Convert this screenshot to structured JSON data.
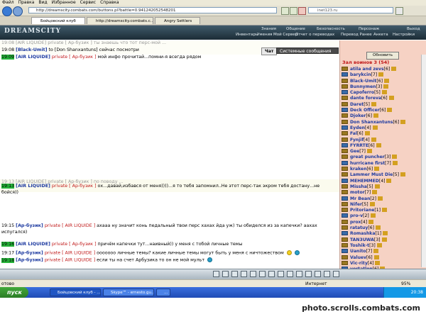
{
  "menu": [
    "Файл",
    "Правка",
    "Вид",
    "Избранное",
    "Сервис",
    "Справка"
  ],
  "address": {
    "url": "http://dreamscity.combats.com/buttons.pl?battle=0.941242052548201",
    "search": "inet123.ru"
  },
  "tabs": [
    {
      "label": "Бойцовский клуб"
    },
    {
      "label": "http://dreamscity.combats.c..."
    },
    {
      "label": "Angry Settlers"
    }
  ],
  "game": {
    "logo": "DREAMSCITY",
    "nav_top": [
      "Знания",
      "Общение",
      "Безопасность",
      "Персонаж",
      "Выход"
    ],
    "nav_bottom": [
      "Инвентарь",
      "Умения",
      "Мой Сервер",
      "Отчет о переводах",
      "Перевод Ранее",
      "Анкета",
      "Настройки"
    ]
  },
  "chat": {
    "tab_chat": "Чат",
    "tab_system": "Системные сообщения",
    "top_lines": [
      {
        "time": "19:08",
        "nick": "Black-Umit",
        "text": " to [Don Shanxantuns] сейчас посмотри"
      },
      {
        "time": "19:09",
        "nick": "AIR LIQUIDE",
        "private": "private [ Ар-бузик ]",
        "text": " мой инфо прочитай...помни-я всегда рядом"
      }
    ],
    "faded_top": "19:08 [AIR LIQUIDE] private [ Ар-бузик ] ты знаешь что тот перс-мой ...",
    "mid_lines": [
      {
        "time": "19:13",
        "nick": "AIR LIQUIDE",
        "private": "private [ Ар-бузик ]",
        "text": " ох...давай,избався от меня))))...я то тебя запомнил..Не этот перс-так экром тебя достану...не"
      },
      {
        "time": "",
        "nick": "",
        "private": "",
        "text": "бойся))"
      }
    ],
    "faded_mid": "19:13 [AIR LIQUIDE] private [ Ар-бузик ] по поводу ...",
    "bottom_lines": [
      {
        "time": "19:15",
        "nick": "Ар-бузик",
        "private": "private [ AIR LIQUIDE ]",
        "text": " ахааа ну значит конь педальный твои перс хахах йда уж) ты обиделся из за капечки? аахах"
      },
      {
        "time": "",
        "nick": "",
        "private": "",
        "text": "испугался)"
      },
      {
        "time": "19:16",
        "nick": "AIR LIQUIDE",
        "private": "private [ Ар-бузик ]",
        "text": " причём капечки тут...наивный)) у меня с тобой личные темы"
      },
      {
        "time": "19:17",
        "nick": "Ар-бузик",
        "private": "private [ AIR LIQUIDE ]",
        "text": " ооооооо    личные темы?  какие личные темы могут быть у меня с ничтожеством"
      },
      {
        "time": "19:18",
        "nick": "Ар-бузик",
        "private": "private [ AIR LIQUIDE ]",
        "text": " если ты на счет Арбузика то он не мой мульт"
      }
    ]
  },
  "users": {
    "refresh": "Обновить",
    "room": "Зал воинов 3 (54)",
    "list": [
      {
        "name": "atila and zevs",
        "lvl": "[6]"
      },
      {
        "name": "barykcin",
        "lvl": "[7]"
      },
      {
        "name": "Black-Umit",
        "lvl": "[6]"
      },
      {
        "name": "Bunnymen",
        "lvl": "[3]"
      },
      {
        "name": "Capoferro",
        "lvl": "[5]"
      },
      {
        "name": "dante foreva",
        "lvl": "[6]"
      },
      {
        "name": "Daret",
        "lvl": "[5]"
      },
      {
        "name": "Deck Officer",
        "lvl": "[6]"
      },
      {
        "name": "Djoker",
        "lvl": "[6]"
      },
      {
        "name": "Don Shanxantuns",
        "lvl": "[6]"
      },
      {
        "name": "Eyden",
        "lvl": "[4]"
      },
      {
        "name": "Fal",
        "lvl": "[6]"
      },
      {
        "name": "Fynjif",
        "lvl": "[4]"
      },
      {
        "name": "FYRRTE",
        "lvl": "[6]"
      },
      {
        "name": "Gee",
        "lvl": "[7]"
      },
      {
        "name": "great puncher",
        "lvl": "[3]"
      },
      {
        "name": "hurricane first",
        "lvl": "[7]"
      },
      {
        "name": "kraken",
        "lvl": "[6]"
      },
      {
        "name": "Lammer Must Die",
        "lvl": "[5]"
      },
      {
        "name": "MEHEMMED",
        "lvl": "[4]"
      },
      {
        "name": "Missha",
        "lvl": "[5]"
      },
      {
        "name": "motor",
        "lvl": "[7]"
      },
      {
        "name": "Mr Bean",
        "lvl": "[2]"
      },
      {
        "name": "Nifer",
        "lvl": "[5]"
      },
      {
        "name": "Pritoriane",
        "lvl": "[1]"
      },
      {
        "name": "pro-v",
        "lvl": "[2]"
      },
      {
        "name": "prox",
        "lvl": "[4]"
      },
      {
        "name": "ratatuy",
        "lvl": "[6]"
      },
      {
        "name": "Romashka",
        "lvl": "[1]"
      },
      {
        "name": "TAN3UWA",
        "lvl": "[3]"
      },
      {
        "name": "Toshik-t",
        "lvl": "[3]"
      },
      {
        "name": "Uanito",
        "lvl": "[7]"
      },
      {
        "name": "Valuev",
        "lvl": "[6]"
      },
      {
        "name": "Vic-rity",
        "lvl": "[4]"
      },
      {
        "name": "vortatlon",
        "lvl": "[6]"
      }
    ]
  },
  "status": {
    "left": "отово",
    "zone": "Интернет",
    "zoom": "95%"
  },
  "taskbar": {
    "start": "пуск",
    "items": [
      "Бойцовский клуб - ...",
      "Skype™ - ernesto.gu...",
      "..."
    ],
    "clock": "20:38"
  },
  "watermark": "photo.scrolls.combats.com",
  "colors": {
    "nick": "#1d3aa0",
    "private": "#c01818",
    "time_highlight": "#26b53a",
    "userlist_bg": "#f6d2c4",
    "header": "#1c2c36"
  }
}
